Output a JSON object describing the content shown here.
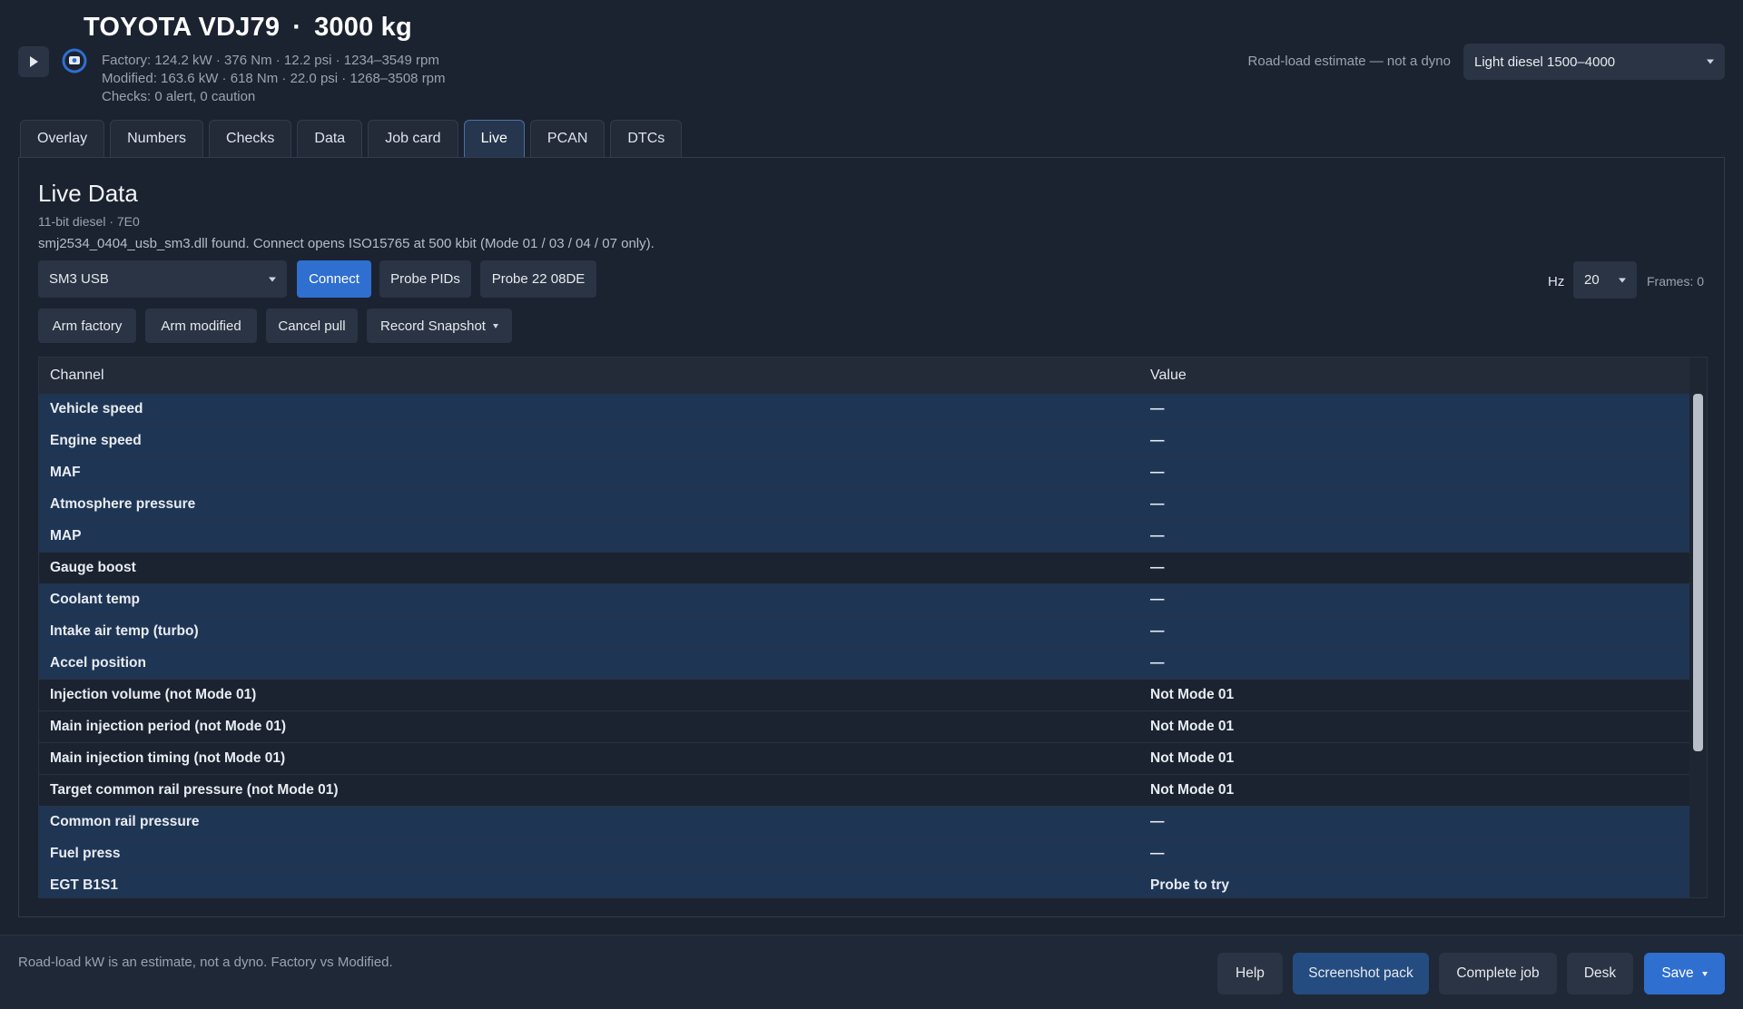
{
  "header": {
    "vehicle": "TOYOTA VDJ79",
    "separator": "·",
    "mass": "3000 kg",
    "specs": {
      "factory": "Factory: 124.2 kW  ·  376 Nm  ·  12.2 psi  ·  1234–3549 rpm",
      "modified": "Modified: 163.6 kW  ·  618 Nm  ·  22.0 psi  ·  1268–3508 rpm",
      "checks": "Checks: 0 alert, 0 caution"
    },
    "road_note": "Road-load estimate — not a dyno",
    "profile_select": "Light diesel 1500–4000",
    "icons": {
      "play": "play-icon",
      "record": "record-icon"
    }
  },
  "tabs": [
    {
      "label": "Overlay"
    },
    {
      "label": "Numbers"
    },
    {
      "label": "Checks"
    },
    {
      "label": "Data"
    },
    {
      "label": "Job card"
    },
    {
      "label": "Live",
      "active": true
    },
    {
      "label": "PCAN"
    },
    {
      "label": "DTCs"
    }
  ],
  "live": {
    "title": "Live Data",
    "subtitle": "11-bit diesel · 7E0",
    "status": "smj2534_0404_usb_sm3.dll found. Connect opens ISO15765 at 500 kbit (Mode 01 / 03 / 04 / 07 only).",
    "device_select": "SM3 USB",
    "buttons": {
      "connect": "Connect",
      "probe_pids": "Probe PIDs",
      "probe_22": "Probe 22 08DE",
      "arm_factory": "Arm factory",
      "arm_modified": "Arm modified",
      "cancel_pull": "Cancel pull",
      "record_snapshot": "Record Snapshot"
    },
    "hz_label": "Hz",
    "hz_value": "20",
    "frames": "Frames: 0",
    "columns": {
      "channel": "Channel",
      "value": "Value"
    },
    "rows": [
      {
        "channel": "Vehicle speed",
        "value": "—",
        "highlight": true
      },
      {
        "channel": "Engine speed",
        "value": "—",
        "highlight": true
      },
      {
        "channel": "MAF",
        "value": "—",
        "highlight": true
      },
      {
        "channel": "Atmosphere pressure",
        "value": "—",
        "highlight": true
      },
      {
        "channel": "MAP",
        "value": "—",
        "highlight": true
      },
      {
        "channel": "Gauge boost",
        "value": "—",
        "highlight": false
      },
      {
        "channel": "Coolant temp",
        "value": "—",
        "highlight": true
      },
      {
        "channel": "Intake air temp (turbo)",
        "value": "—",
        "highlight": true
      },
      {
        "channel": "Accel position",
        "value": "—",
        "highlight": true
      },
      {
        "channel": "Injection volume  (not Mode 01)",
        "value": "Not Mode 01",
        "highlight": false
      },
      {
        "channel": "Main injection period  (not Mode 01)",
        "value": "Not Mode 01",
        "highlight": false
      },
      {
        "channel": "Main injection timing  (not Mode 01)",
        "value": "Not Mode 01",
        "highlight": false
      },
      {
        "channel": "Target common rail pressure  (not Mode 01)",
        "value": "Not Mode 01",
        "highlight": false
      },
      {
        "channel": "Common rail pressure",
        "value": "—",
        "highlight": true
      },
      {
        "channel": "Fuel press",
        "value": "—",
        "highlight": true
      },
      {
        "channel": "EGT B1S1",
        "value": "Probe to try",
        "highlight": true
      }
    ]
  },
  "footer": {
    "note": "Road-load kW is an estimate, not a dyno. Factory vs Modified.",
    "help": "Help",
    "screenshot_pack": "Screenshot pack",
    "complete_job": "Complete job",
    "desk": "Desk",
    "save": "Save"
  },
  "colors": {
    "background": "#1b2230",
    "accent": "#2f6fd0",
    "row_highlight": "#1f3554"
  }
}
